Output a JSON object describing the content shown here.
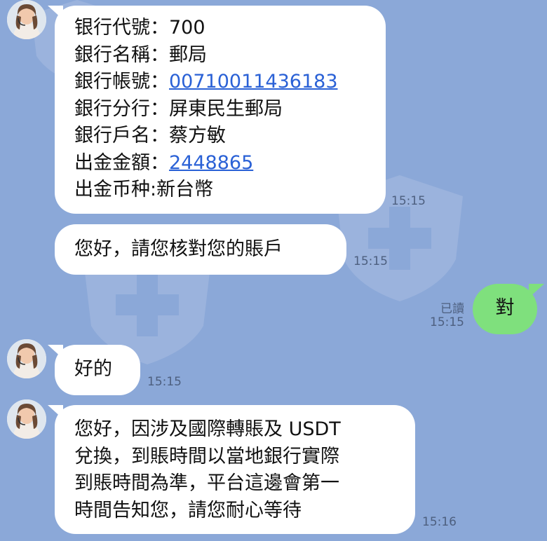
{
  "chat": {
    "messages": [
      {
        "side": "left",
        "lines": [
          {
            "label": "银行代號：",
            "value": "700"
          },
          {
            "label": "銀行名稱：",
            "value": "郵局"
          },
          {
            "label": "銀行帳號：",
            "value": "00710011436183",
            "link": true
          },
          {
            "label": "銀行分行：",
            "value": "屏東民生郵局"
          },
          {
            "label": "銀行戶名：",
            "value": "蔡方敏"
          },
          {
            "label": "出金金額：",
            "value": "2448865",
            "link": true
          },
          {
            "label": "出金币种:",
            "value": "新台幣"
          }
        ],
        "time": "15:15"
      },
      {
        "side": "left",
        "text": "您好，請您核對您的賬戶",
        "time": "15:15"
      },
      {
        "side": "right",
        "text": "對",
        "read": "已讀",
        "time": "15:15"
      },
      {
        "side": "left",
        "text": "好的",
        "time": "15:15"
      },
      {
        "side": "left",
        "lines_text": [
          "您好，因涉及國際轉賬及 USDT",
          "兌換，到賬時間以當地銀行實際",
          "到賬時間為準，平台這邊會第一",
          "時間告知您，請您耐心等待"
        ],
        "time": "15:16"
      }
    ]
  },
  "colors": {
    "background": "#8ba8d8",
    "bubble_other": "#ffffff",
    "bubble_mine": "#7fe07d",
    "link": "#2a61d6"
  },
  "icons": [
    "agent-avatar",
    "shield-watermark-icon"
  ]
}
